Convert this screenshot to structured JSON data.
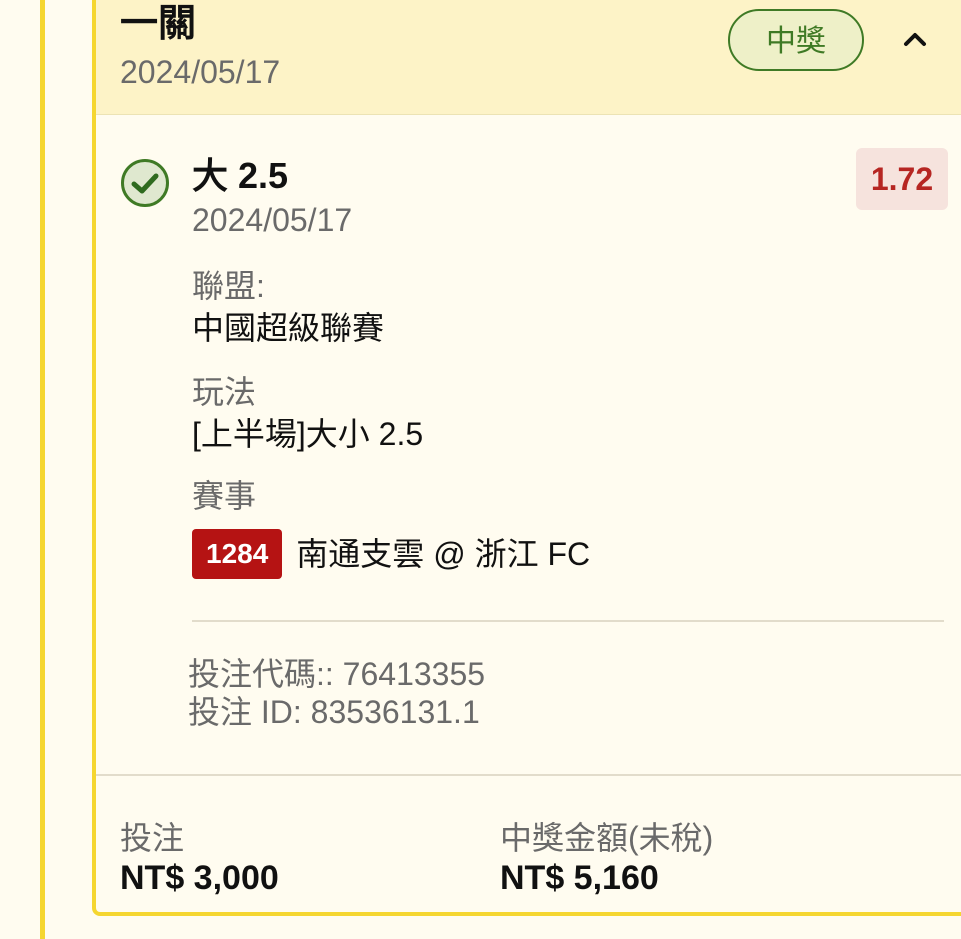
{
  "header": {
    "bet_type": "一關",
    "date": "2024/05/17",
    "status": "中獎",
    "collapse_icon": "chevron-up-icon"
  },
  "selection": {
    "status_icon": "check-circle-icon",
    "title": "大 2.5",
    "date": "2024/05/17",
    "odds": "1.72"
  },
  "details": {
    "league_label": "聯盟:",
    "league_value": "中國超級聯賽",
    "market_label": "玩法",
    "market_value": "[上半場]大小 2.5",
    "event_label": "賽事",
    "event_id": "1284",
    "event_name": "南通支雲 @ 浙江 FC"
  },
  "meta": {
    "bet_code": "投注代碼:: 76413355",
    "bet_id": "投注 ID: 83536131.1"
  },
  "footer": {
    "stake_label": "投注",
    "stake_value": "NT$ 3,000",
    "payout_label": "中獎金額(未稅)",
    "payout_value": "NT$ 5,160"
  },
  "colors": {
    "accent_border": "#f5d630",
    "header_bg": "#fdf3c7",
    "win_green": "#3f7a25",
    "odds_red": "#b62622",
    "event_badge": "#b51313"
  }
}
